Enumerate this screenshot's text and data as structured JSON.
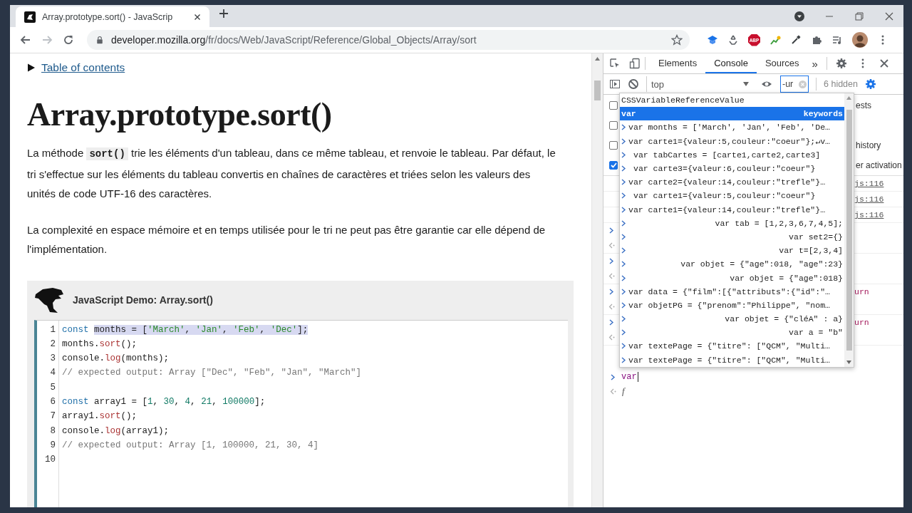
{
  "browser": {
    "tab": {
      "title": "Array.prototype.sort() - JavaScrip",
      "selected": true
    },
    "address": {
      "host": "developer.mozilla.org",
      "path": "/fr/docs/Web/JavaScript/Reference/Global_Objects/Array/sort"
    },
    "extension_badge": "ABP"
  },
  "page": {
    "toc_link": "Table of contents",
    "title": "Array.prototype.sort()",
    "paragraphs": [
      "La méthode **sort()** trie les éléments d'un tableau, dans ce même tableau, et renvoie le tableau. Par défaut, le tri s'effectue sur les éléments du tableau convertis en chaînes de caractères et triées selon les valeurs des unités de code UTF-16 des caractères.",
      "La complexité en espace mémoire et en temps utilisée pour le tri ne peut pas être garantie car elle dépend de l'implémentation."
    ],
    "demo": {
      "title": "JavaScript Demo: Array.sort()",
      "lines": [
        {
          "number": "1",
          "tokens": [
            {
              "kind": "keyword",
              "text": "const ",
              "highlighted": false
            },
            {
              "kind": "plain",
              "text": "months = [",
              "highlighted": true
            },
            {
              "kind": "string",
              "text": "'March'",
              "highlighted": true
            },
            {
              "kind": "plain",
              "text": ", ",
              "highlighted": true
            },
            {
              "kind": "string",
              "text": "'Jan'",
              "highlighted": true
            },
            {
              "kind": "plain",
              "text": ", ",
              "highlighted": true
            },
            {
              "kind": "string",
              "text": "'Feb'",
              "highlighted": true
            },
            {
              "kind": "plain",
              "text": ", ",
              "highlighted": true
            },
            {
              "kind": "string",
              "text": "'Dec'",
              "highlighted": true
            },
            {
              "kind": "plain",
              "text": "];",
              "highlighted": true
            }
          ]
        },
        {
          "number": "2",
          "tokens": [
            {
              "kind": "plain",
              "text": "months."
            },
            {
              "kind": "method",
              "text": "sort"
            },
            {
              "kind": "plain",
              "text": "();"
            }
          ]
        },
        {
          "number": "3",
          "tokens": [
            {
              "kind": "plain",
              "text": "console."
            },
            {
              "kind": "method",
              "text": "log"
            },
            {
              "kind": "plain",
              "text": "(months);"
            }
          ]
        },
        {
          "number": "4",
          "tokens": [
            {
              "kind": "comment",
              "text": "// expected output: Array [\"Dec\", \"Feb\", \"Jan\", \"March\"]"
            }
          ]
        },
        {
          "number": "5"
        },
        {
          "number": "6",
          "tokens": [
            {
              "kind": "keyword",
              "text": "const"
            },
            {
              "kind": "plain",
              "text": " array1 = ["
            },
            {
              "kind": "number",
              "text": "1"
            },
            {
              "kind": "plain",
              "text": ", "
            },
            {
              "kind": "number",
              "text": "30"
            },
            {
              "kind": "plain",
              "text": ", "
            },
            {
              "kind": "number",
              "text": "4"
            },
            {
              "kind": "plain",
              "text": ", "
            },
            {
              "kind": "number",
              "text": "21"
            },
            {
              "kind": "plain",
              "text": ", "
            },
            {
              "kind": "number",
              "text": "100000"
            },
            {
              "kind": "plain",
              "text": "];"
            }
          ]
        },
        {
          "number": "7",
          "tokens": [
            {
              "kind": "plain",
              "text": "array1."
            },
            {
              "kind": "method",
              "text": "sort"
            },
            {
              "kind": "plain",
              "text": "();"
            }
          ]
        },
        {
          "number": "8",
          "tokens": [
            {
              "kind": "plain",
              "text": "console."
            },
            {
              "kind": "method",
              "text": "log"
            },
            {
              "kind": "plain",
              "text": "(array1);"
            }
          ]
        },
        {
          "number": "9",
          "tokens": [
            {
              "kind": "comment",
              "text": "// expected output: Array [1, 100000, 21, 30, 4]"
            }
          ]
        },
        {
          "number": "10"
        }
      ]
    }
  },
  "devtools": {
    "tabs": [
      {
        "label": "Elements",
        "selected": false
      },
      {
        "label": "Console",
        "selected": true
      },
      {
        "label": "Sources",
        "selected": false
      }
    ],
    "more_tabs": "»",
    "context": "top",
    "filter": "-ur",
    "hidden_count": "6 hidden",
    "settings": [
      {
        "label_fragment": "ests",
        "checked": false
      },
      {
        "checked": false
      },
      {
        "label_fragment": "history",
        "checked": false
      },
      {
        "label_fragment": "er activation",
        "checked": true
      }
    ],
    "messages": [
      {
        "kind": "log",
        "source": "js:116"
      },
      {
        "kind": "log",
        "source": "js:116"
      },
      {
        "kind": "log",
        "source": "js:116"
      },
      {
        "kind": "input"
      },
      {
        "kind": "output"
      },
      {
        "kind": "input"
      },
      {
        "kind": "output"
      },
      {
        "kind": "input",
        "fragment": "urn"
      },
      {
        "kind": "output"
      },
      {
        "kind": "input",
        "fragment": "urn"
      },
      {
        "kind": "output"
      }
    ],
    "prompt": {
      "value": "var",
      "result": "f"
    },
    "autocomplete": [
      {
        "kind": "suggestion",
        "text": "CSSVariableReferenceValue",
        "selected": false
      },
      {
        "kind": "suggestion",
        "text": "var",
        "hint": "keywords",
        "selected": true
      },
      {
        "kind": "history",
        "text": "var months = ['March', 'Jan', 'Feb', 'De…",
        "selected": false
      },
      {
        "kind": "history",
        "text": "var carte1={valeur:5,couleur:\"coeur\"};↵v…",
        "selected": false
      },
      {
        "kind": "history-indent",
        "text": "var tabCartes = [carte1,carte2,carte3]",
        "selected": false
      },
      {
        "kind": "history-indent",
        "text": "var carte3={valeur:6,couleur:\"coeur\"}",
        "selected": false
      },
      {
        "kind": "history",
        "text": "var carte2={valeur:14,couleur:\"trefle\"}…",
        "selected": false
      },
      {
        "kind": "history-indent",
        "text": "var carte1={valeur:5,couleur:\"coeur\"}",
        "selected": false
      },
      {
        "kind": "history",
        "text": "var carte1={valeur:14,couleur:\"trefle\"}…",
        "selected": false
      },
      {
        "kind": "history-right",
        "text": "var tab = [1,2,3,6,7,4,5];",
        "selected": false
      },
      {
        "kind": "history-right",
        "text": "var set2={}",
        "selected": false
      },
      {
        "kind": "history-right",
        "text": "var t=[2,3,4]",
        "selected": false
      },
      {
        "kind": "history-right",
        "text": "var objet = {\"age\":018, \"age\":23}",
        "selected": false
      },
      {
        "kind": "history-right",
        "text": "var objet = {\"age\":018}",
        "selected": false
      },
      {
        "kind": "history",
        "text": "var data = {\"film\":[{\"attributs\":{\"id\":\"…",
        "selected": false
      },
      {
        "kind": "history",
        "text": "var objetPG = {\"prenom\":\"Philippe\", \"nom…",
        "selected": false
      },
      {
        "kind": "history-right",
        "text": "var objet = {\"cléA\" : a}",
        "selected": false
      },
      {
        "kind": "history-right",
        "text": "var a = \"b\"",
        "selected": false
      },
      {
        "kind": "history",
        "text": "var textePage = {\"titre\": [\"QCM\", \"Multi…",
        "selected": false
      },
      {
        "kind": "history",
        "text": "var textePage = {\"titre\": [\"QCM\", \"Multi…",
        "selected": false
      }
    ]
  }
}
